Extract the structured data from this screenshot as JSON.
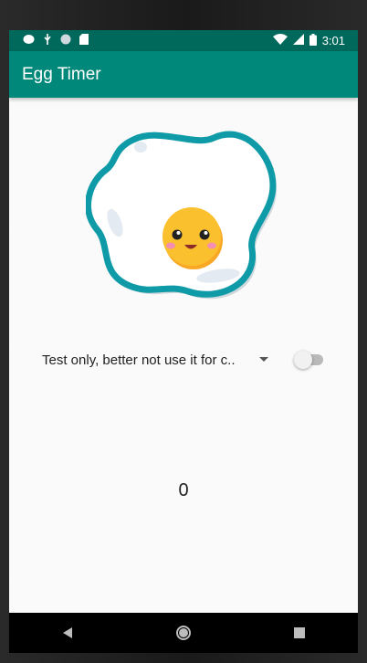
{
  "status_bar": {
    "time": "3:01",
    "left_icons": [
      "notification-cloud-icon",
      "notification-usb-icon",
      "notification-circle-icon",
      "sd-card-icon"
    ],
    "right_icons": [
      "wifi-icon",
      "signal-icon",
      "battery-icon"
    ]
  },
  "app_bar": {
    "title": "Egg Timer"
  },
  "main": {
    "spinner": {
      "selected": "Test only, better not use it for c.."
    },
    "switch": {
      "on": false
    },
    "timer_value": "0"
  },
  "nav_bar": {
    "buttons": [
      "back-icon",
      "home-icon",
      "recents-icon"
    ]
  },
  "colors": {
    "status_bar": "#00695c",
    "app_bar": "#00897b",
    "egg_outline": "#0e9aa7",
    "yolk": "#fbc02d"
  }
}
